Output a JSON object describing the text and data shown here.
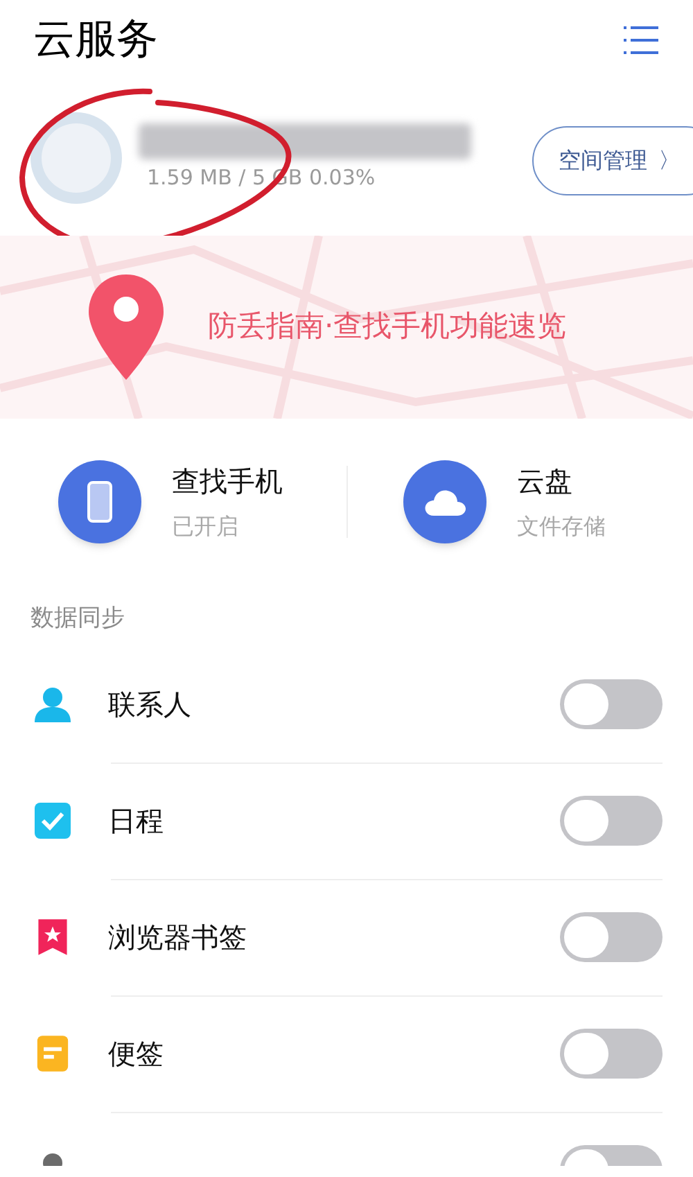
{
  "title": "云服务",
  "account": {
    "storage": "1.59 MB / 5 GB 0.03%",
    "manage_button": "空间管理",
    "manage_arrow": "〉"
  },
  "banner": {
    "text": "防丢指南·查找手机功能速览"
  },
  "services": [
    {
      "kind": "phone",
      "title": "查找手机",
      "subtitle": "已开启"
    },
    {
      "kind": "cloud",
      "title": "云盘",
      "subtitle": "文件存储"
    }
  ],
  "sync": {
    "label": "数据同步",
    "items": [
      {
        "kind": "contacts",
        "label": "联系人",
        "on": false
      },
      {
        "kind": "calendar",
        "label": "日程",
        "on": false
      },
      {
        "kind": "bookmark",
        "label": "浏览器书签",
        "on": false
      },
      {
        "kind": "note",
        "label": "便签",
        "on": false
      },
      {
        "kind": "blocklist",
        "on": false
      }
    ]
  }
}
